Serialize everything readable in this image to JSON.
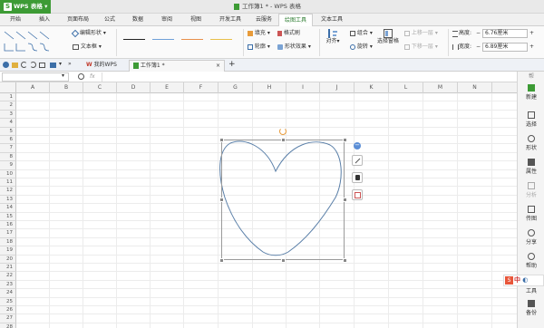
{
  "app": {
    "name": "WPS 表格",
    "logo": "S"
  },
  "window": {
    "title": "工作簿1 * - WPS 表格"
  },
  "ribbon_tabs": [
    "开始",
    "插入",
    "页面布局",
    "公式",
    "数据",
    "审阅",
    "视图",
    "开发工具",
    "云服务",
    "绘图工具",
    "文本工具"
  ],
  "active_tab": "绘图工具",
  "ribbon": {
    "edit_shape": "编辑形状",
    "text_box": "文本框",
    "fill": "填充",
    "format_painter": "格式刷",
    "outline": "轮廓",
    "shape_effects": "形状效果",
    "align": "对齐",
    "group": "组合",
    "rotate": "旋转",
    "selection_pane": "选择窗格",
    "bring_forward": "上移一层",
    "send_backward": "下移一层",
    "height_label": "高度:",
    "height_value": "6.76厘米",
    "width_label": "宽度:",
    "width_value": "6.89厘米"
  },
  "doc_tabs": {
    "my_wps": "我的WPS",
    "workbook": "工作簿1 *",
    "add": "+"
  },
  "formula_bar": {
    "fx": "fx",
    "zoom_icon": "zoom-icon"
  },
  "columns": [
    "A",
    "B",
    "C",
    "D",
    "E",
    "F",
    "G",
    "H",
    "I",
    "J",
    "K",
    "L",
    "M",
    "N"
  ],
  "rows": [
    "1",
    "2",
    "3",
    "4",
    "5",
    "6",
    "7",
    "8",
    "9",
    "10",
    "11",
    "12",
    "13",
    "14",
    "15",
    "16",
    "17",
    "18",
    "19",
    "20",
    "21",
    "22",
    "23",
    "24",
    "25",
    "26",
    "27",
    "28"
  ],
  "right_panel": [
    {
      "icon": "new-icon",
      "label": "新建"
    },
    {
      "icon": "select-icon",
      "label": "选择"
    },
    {
      "icon": "shape-icon",
      "label": "形状"
    },
    {
      "icon": "property-icon",
      "label": "属性"
    },
    {
      "icon": "share-icon",
      "label": "分析"
    },
    {
      "icon": "backup-icon",
      "label": "传图"
    },
    {
      "icon": "share2-icon",
      "label": "分享"
    },
    {
      "icon": "help-icon",
      "label": "帮助"
    },
    {
      "icon": "tool-icon",
      "label": "工具"
    },
    {
      "icon": "backup2-icon",
      "label": "备份"
    }
  ],
  "right_panel_top": "帮",
  "ime": {
    "mode": "中"
  },
  "colors": {
    "accent_green": "#3d9b35",
    "selection_handle": "#888888",
    "heart_stroke": "#5a7fa8"
  }
}
